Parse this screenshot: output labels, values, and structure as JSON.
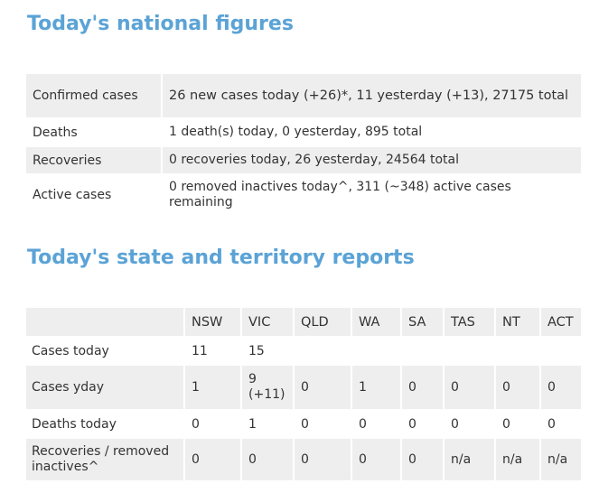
{
  "national": {
    "heading": "Today's national figures",
    "rows": [
      {
        "label": "Confirmed cases",
        "value": "26 new cases today (+26)*, 11 yesterday (+13), 27175 total"
      },
      {
        "label": "Deaths",
        "value": "1 death(s) today, 0 yesterday, 895 total"
      },
      {
        "label": "Recoveries",
        "value": "0 recoveries today, 26 yesterday, 24564 total"
      },
      {
        "label": "Active cases",
        "value": "0 removed inactives today^, 311 (~348) active cases remaining"
      }
    ]
  },
  "states": {
    "heading": "Today's state and territory reports",
    "columns": [
      "NSW",
      "VIC",
      "QLD",
      "WA",
      "SA",
      "TAS",
      "NT",
      "ACT"
    ],
    "rows": [
      {
        "label": "Cases today",
        "values": [
          "11",
          "15",
          "",
          "",
          "",
          "",
          "",
          ""
        ]
      },
      {
        "label": "Cases yday",
        "values": [
          "1",
          "9 (+11)",
          "0",
          "1",
          "0",
          "0",
          "0",
          "0"
        ]
      },
      {
        "label": "Deaths today",
        "values": [
          "0",
          "1",
          "0",
          "0",
          "0",
          "0",
          "0",
          "0"
        ]
      },
      {
        "label": "Recoveries / removed inactives^",
        "values": [
          "0",
          "0",
          "0",
          "0",
          "0",
          "n/a",
          "n/a",
          "n/a"
        ]
      }
    ]
  }
}
